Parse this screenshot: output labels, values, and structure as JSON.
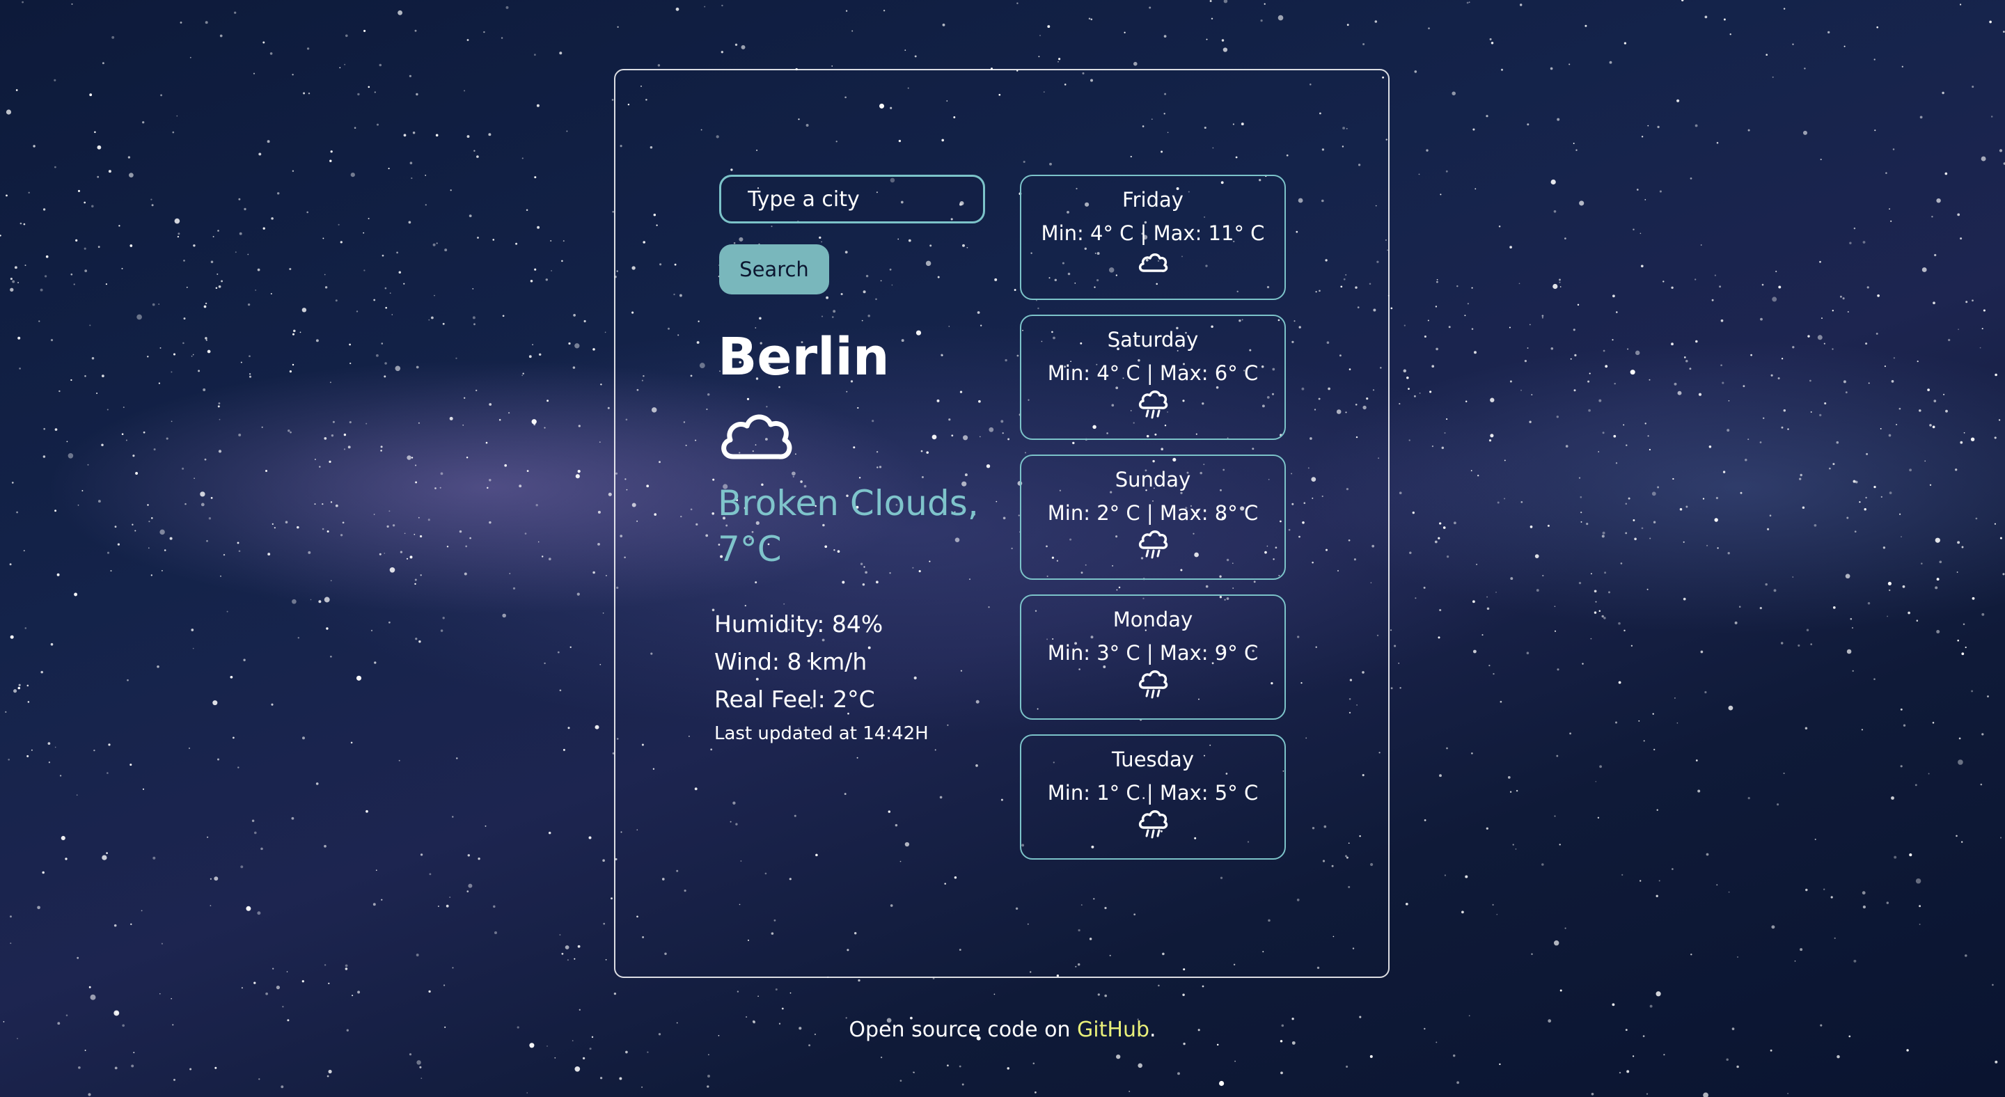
{
  "search": {
    "placeholder": "Type a city",
    "button_label": "Search"
  },
  "current": {
    "city": "Berlin",
    "icon": "cloud-icon",
    "description": "Broken Clouds,",
    "temperature": "7°C",
    "humidity": "Humidity: 84%",
    "wind": "Wind: 8 km/h",
    "real_feel": "Real Feel: 2°C",
    "last_updated": "Last updated at 14:42H"
  },
  "forecast": [
    {
      "day": "Friday",
      "temps": "Min: 4° C | Max: 11° C",
      "icon": "cloud-icon"
    },
    {
      "day": "Saturday",
      "temps": "Min: 4° C | Max: 6° C",
      "icon": "rain-cloud-icon"
    },
    {
      "day": "Sunday",
      "temps": "Min: 2° C | Max: 8° C",
      "icon": "rain-cloud-icon"
    },
    {
      "day": "Monday",
      "temps": "Min: 3° C | Max: 9° C",
      "icon": "rain-cloud-icon"
    },
    {
      "day": "Tuesday",
      "temps": "Min: 1° C | Max: 5° C",
      "icon": "rain-cloud-icon"
    }
  ],
  "footer": {
    "text": "Open source code on ",
    "link_text": "GitHub",
    "suffix": "."
  },
  "colors": {
    "accent": "#7cc3c9",
    "button_bg": "#79b7bc",
    "link": "#e9f07a"
  }
}
